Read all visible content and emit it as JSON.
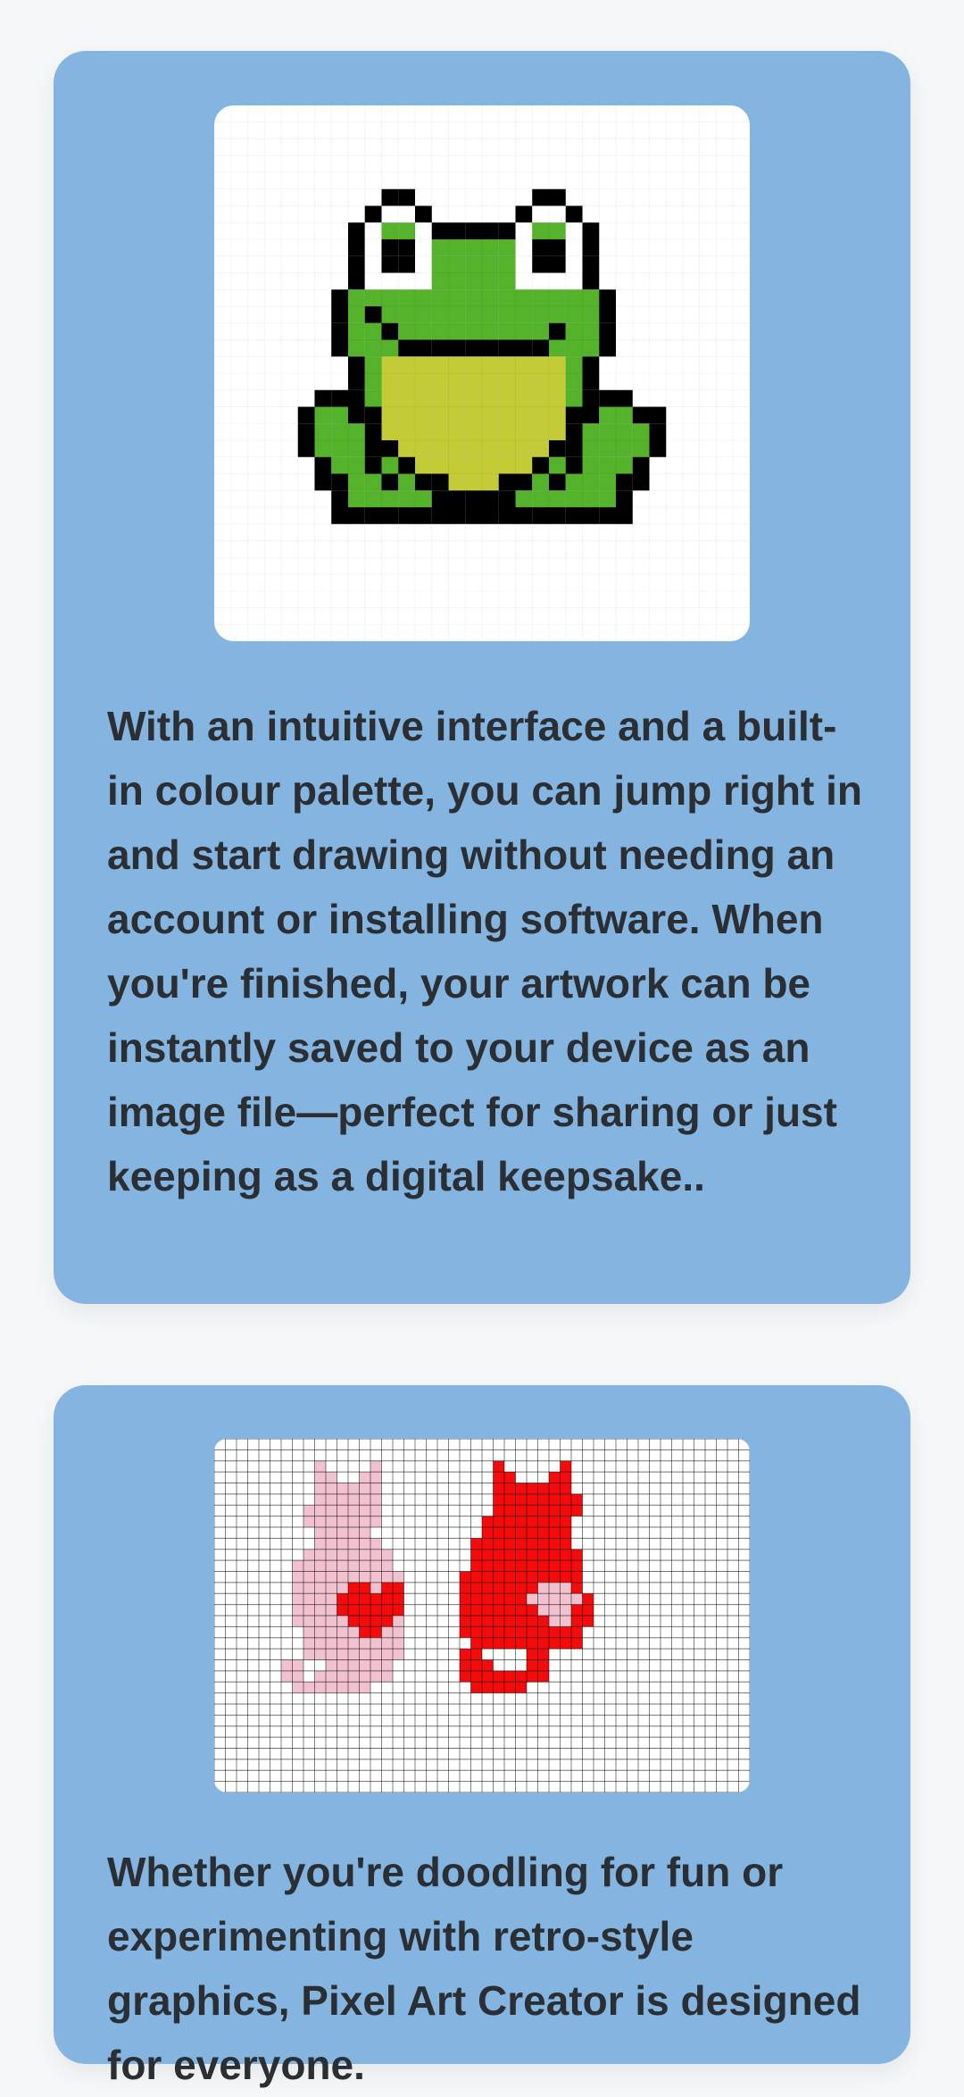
{
  "cards": [
    {
      "image_name": "frog pixel art",
      "text": "With an intuitive interface and a built-in colour palette, you can jump right in and start drawing without needing an account or installing software. When you're finished, your artwork can be instantly saved to your device as an image file—perfect for sharing or just keeping as a digital keepsake.."
    },
    {
      "image_name": "cats pixel art",
      "text": "Whether you're doodling for fun or experimenting with retro-style graphics, Pixel Art Creator is designed for everyone."
    }
  ],
  "colors": {
    "page_background": "#f6f7f9",
    "card_background": "#84b5e1",
    "text": "#2b2f33",
    "frog_green": "#54b22b",
    "frog_belly": "#c3cc36",
    "outline": "#000000",
    "cat_pink": "#f2c1d0",
    "cat_red": "#f40c0c"
  }
}
